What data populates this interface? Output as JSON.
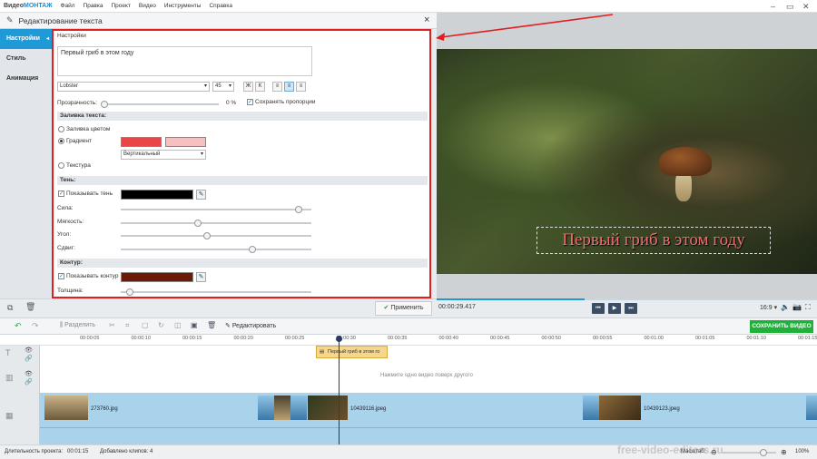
{
  "app": {
    "logo_a": "Видео",
    "logo_b": "МОНТАЖ"
  },
  "menu": [
    "Файл",
    "Правка",
    "Проект",
    "Видео",
    "Инструменты",
    "Справка"
  ],
  "dialog": {
    "title": "Редактирование текста",
    "close": "×"
  },
  "tabs": [
    "Настройки",
    "Стиль",
    "Анимация"
  ],
  "settings": {
    "section_title": "Настройки",
    "text_value": "Первый гриб в этом году",
    "font": "Lobster",
    "size": "45",
    "bold": "Ж",
    "italic": "К",
    "opacity_label": "Прозрачность:",
    "opacity_value": "0 %",
    "keep_proportions": "Сохранять пропорции",
    "fill_title": "Заливка текста:",
    "fill_color": "Заливка цветом",
    "gradient": "Градиент",
    "gradient_dir": "Вертикальный",
    "texture": "Текстура",
    "grad_color1": "#e94747",
    "grad_color2": "#f6c0c0",
    "shadow_title": "Тень:",
    "show_shadow": "Показывать тень",
    "shadow_color": "#000000",
    "strength": "Сила:",
    "softness": "Мягкость:",
    "angle": "Угол:",
    "offset": "Сдвиг:",
    "outline_title": "Контур:",
    "show_outline": "Показывать контур",
    "outline_color": "#6b1a06",
    "thickness": "Толщина:",
    "strength_level": 0.95,
    "softness_level": 0.4,
    "angle_level": 0.45,
    "offset_level": 0.7,
    "thickness_level": 0.03,
    "opacity_level": 0.0
  },
  "apply": "Применить",
  "preview": {
    "overlay_text": "Первый гриб в этом году",
    "time": "00:00:29.417",
    "ratio": "16:9",
    "progress": 0.39
  },
  "toolbar": {
    "split": "Разделить",
    "edit": "Редактировать",
    "save": "СОХРАНИТЬ ВИДЕО"
  },
  "ruler": [
    "00:00:05",
    "00:00:10",
    "00:00:15",
    "00:00:20",
    "00:00:25",
    "00:00:30",
    "00:00:35",
    "00:00:40",
    "00:00:45",
    "00:00:50",
    "00:00:55",
    "00:01:00",
    "00:01:05",
    "00:01:10",
    "00:01:15"
  ],
  "tracks": {
    "text_clip": "Первый гриб в этом го",
    "hint": "Нажмите одно видео поверх другого",
    "clips": [
      "273760.jpg",
      "10439116.jpeg",
      "10439123.jpeg"
    ]
  },
  "status": {
    "duration_label": "Длительность проекта:",
    "duration": "00:01:15",
    "clips_label": "Добавлено клипов:",
    "clips": "4",
    "scale_label": "Масштаб:",
    "scale": "100%"
  },
  "watermark": "free-video-editors.ru"
}
